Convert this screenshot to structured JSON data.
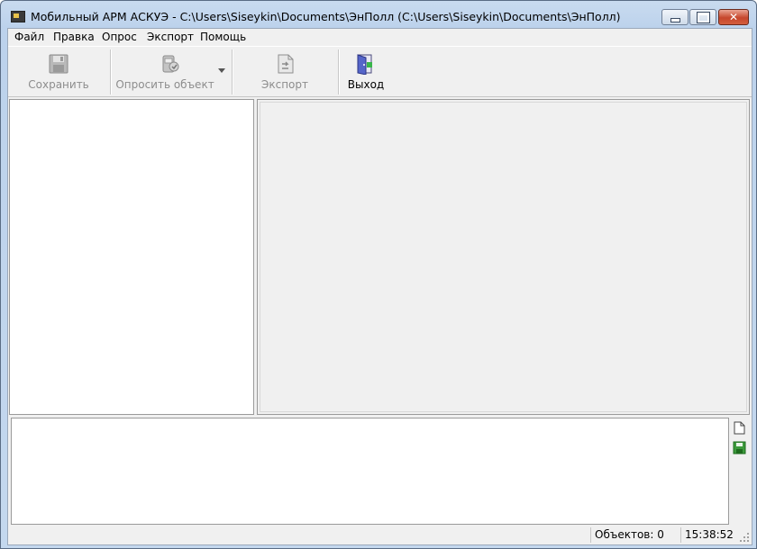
{
  "window": {
    "title": "Мобильный АРМ АСКУЭ - C:\\Users\\Siseykin\\Documents\\ЭнПолл (C:\\Users\\Siseykin\\Documents\\ЭнПолл)",
    "close_glyph": "✕"
  },
  "menu": [
    "Файл",
    "Правка",
    "Опрос",
    "Экспорт",
    "Помощь"
  ],
  "toolbar": {
    "save_label": "Сохранить",
    "poll_label": "Опросить объект",
    "export_label": "Экспорт",
    "exit_label": "Выход"
  },
  "status": {
    "objects": "Объектов: 0",
    "time": "15:38:52"
  }
}
